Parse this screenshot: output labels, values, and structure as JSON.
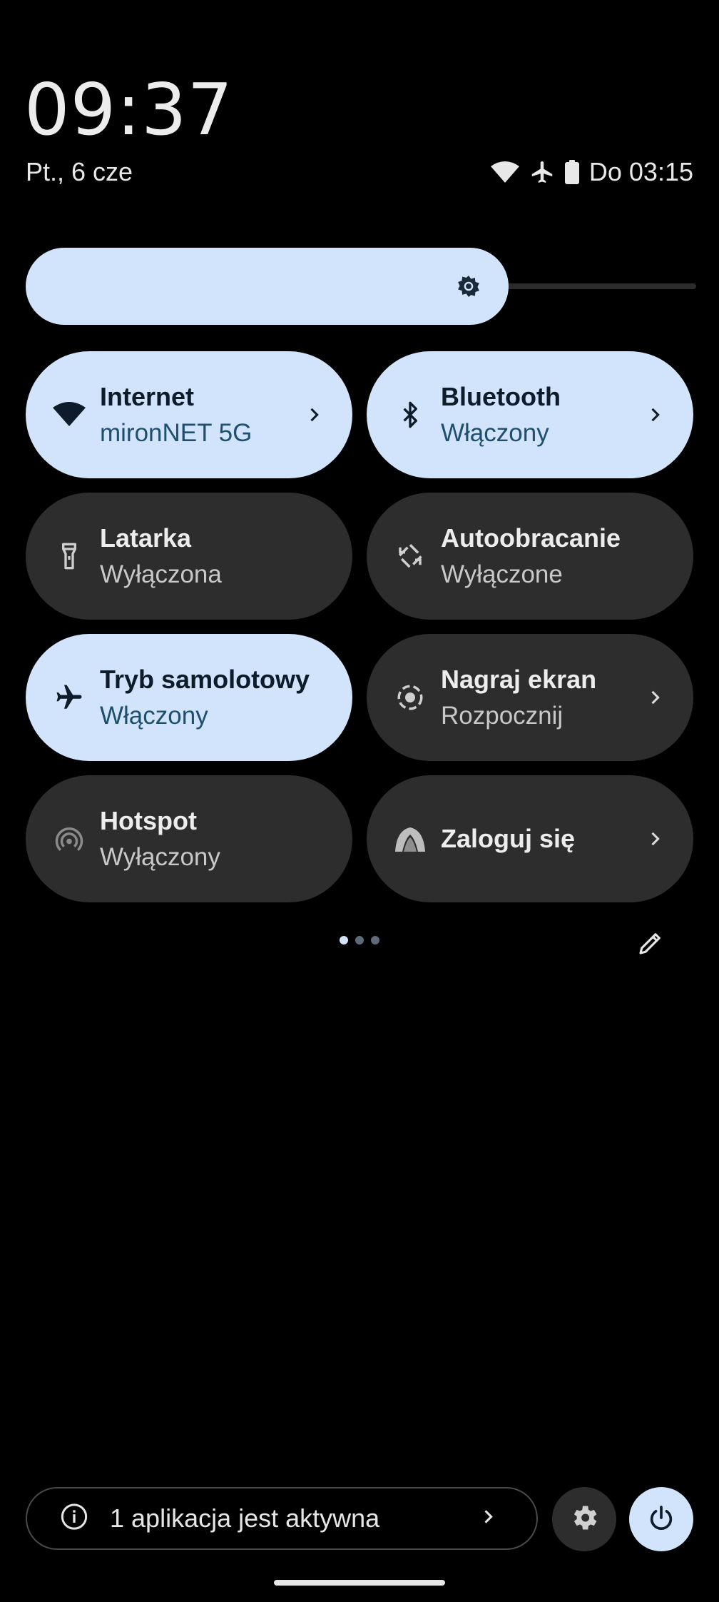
{
  "header": {
    "time": "09:37",
    "date": "Pt., 6 cze",
    "battery_text": "Do 03:15"
  },
  "status_icons": [
    "wifi-icon",
    "airplane-icon",
    "battery-icon"
  ],
  "brightness": {
    "level": 0.72,
    "icon": "brightness-icon"
  },
  "tiles": [
    {
      "title": "Internet",
      "subtitle": "mironNET 5G",
      "state": "on",
      "icon": "wifi-icon",
      "has_chevron": true
    },
    {
      "title": "Bluetooth",
      "subtitle": "Włączony",
      "state": "on",
      "icon": "bluetooth-icon",
      "has_chevron": true
    },
    {
      "title": "Latarka",
      "subtitle": "Wyłączona",
      "state": "off",
      "icon": "flashlight-icon",
      "has_chevron": false
    },
    {
      "title": "Autoobracanie",
      "subtitle": "Wyłączone",
      "state": "off",
      "icon": "auto-rotate-icon",
      "has_chevron": false
    },
    {
      "title": "Tryb samolotowy",
      "subtitle": "Włączony",
      "state": "on",
      "icon": "airplane-icon",
      "has_chevron": false
    },
    {
      "title": "Nagraj ekran",
      "subtitle": "Rozpocznij",
      "state": "off",
      "icon": "screen-record-icon",
      "has_chevron": true
    },
    {
      "title": "Hotspot",
      "subtitle": "Wyłączony",
      "state": "off",
      "icon": "hotspot-icon",
      "has_chevron": false
    },
    {
      "title": "Zaloguj się",
      "subtitle": "",
      "state": "off",
      "icon": "vpn-icon",
      "has_chevron": true
    }
  ],
  "pager": {
    "pages": 3,
    "current": 1
  },
  "footer": {
    "active_apps_label": "1 aplikacja jest aktywna"
  },
  "colors": {
    "background": "#000000",
    "tile_on": "#D2E4FB",
    "tile_off": "#2D2D2D",
    "on_subtitle": "#1E4F6E"
  }
}
